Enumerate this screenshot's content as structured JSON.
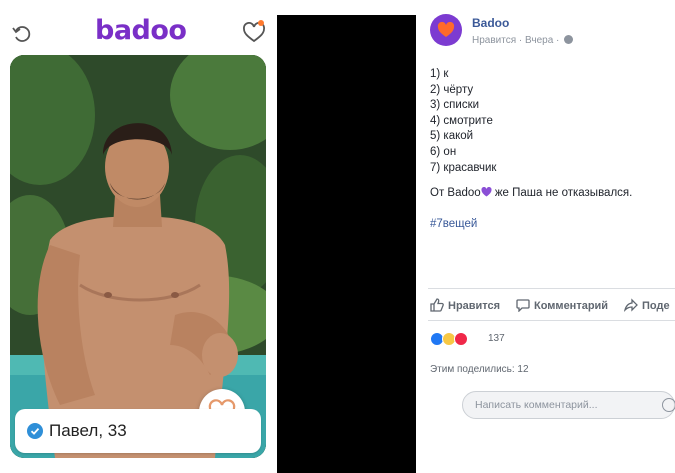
{
  "badoo": {
    "logo": "badoo",
    "profile_name": "Павел, 33",
    "brand_color": "#7a2fc7"
  },
  "post": {
    "page_name": "Badoo",
    "meta_like": "Нравится",
    "meta_time": "Вчера",
    "lines": [
      "1) к",
      "2) чёрту",
      "3) списки",
      "4) смотрите",
      "5) какой",
      "6) он",
      "7) красавчик"
    ],
    "footer_before": "От Badoo",
    "footer_after": " же Паша не отказывался.",
    "hashtag": "#7вещей",
    "actions": {
      "like": "Нравится",
      "comment": "Комментарий",
      "share": "Поде"
    },
    "reaction_count": "137",
    "shares": "Этим поделились: 12",
    "comment_placeholder": "Написать комментарий..."
  },
  "icons": [
    "back-arrow-icon",
    "heart-outline-icon",
    "verified-check-icon",
    "heart-like-icon",
    "thumbs-up-icon",
    "comment-icon",
    "share-icon",
    "globe-icon",
    "emoji-icon"
  ]
}
